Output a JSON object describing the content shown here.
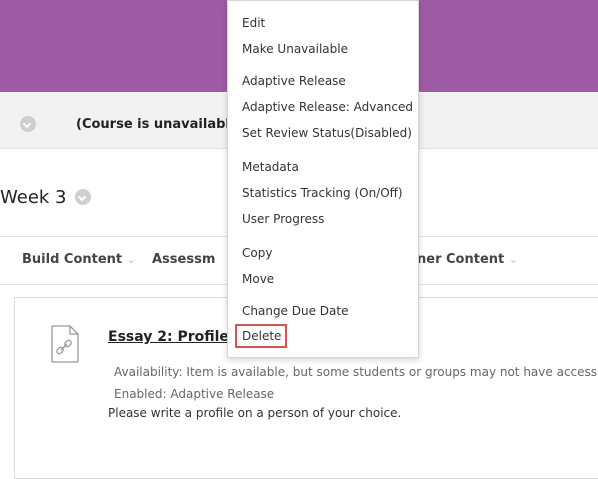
{
  "notice": {
    "text": "(Course is unavailable t"
  },
  "week": {
    "title": "Week 3"
  },
  "toolbar": {
    "build_content": "Build Content",
    "assessments": "Assessm",
    "partner_content": "ner Content",
    "chevron": "⌄"
  },
  "item": {
    "title": "Essay 2: Profile",
    "availability_label": "Availability:",
    "availability_value": "Item is available, but some students or groups may not have access",
    "enabled_label": "Enabled:",
    "enabled_value": "Adaptive Release",
    "description": "Please write a profile on a person of your choice."
  },
  "context_menu": {
    "items": [
      "Edit",
      "Make Unavailable",
      "Adaptive Release",
      "Adaptive Release: Advanced",
      "Set Review Status(Disabled)",
      "Metadata",
      "Statistics Tracking (On/Off)",
      "User Progress",
      "Copy",
      "Move",
      "Change Due Date",
      "Delete"
    ]
  },
  "colors": {
    "banner": "#9d5ba3",
    "highlight": "#d9534f"
  }
}
